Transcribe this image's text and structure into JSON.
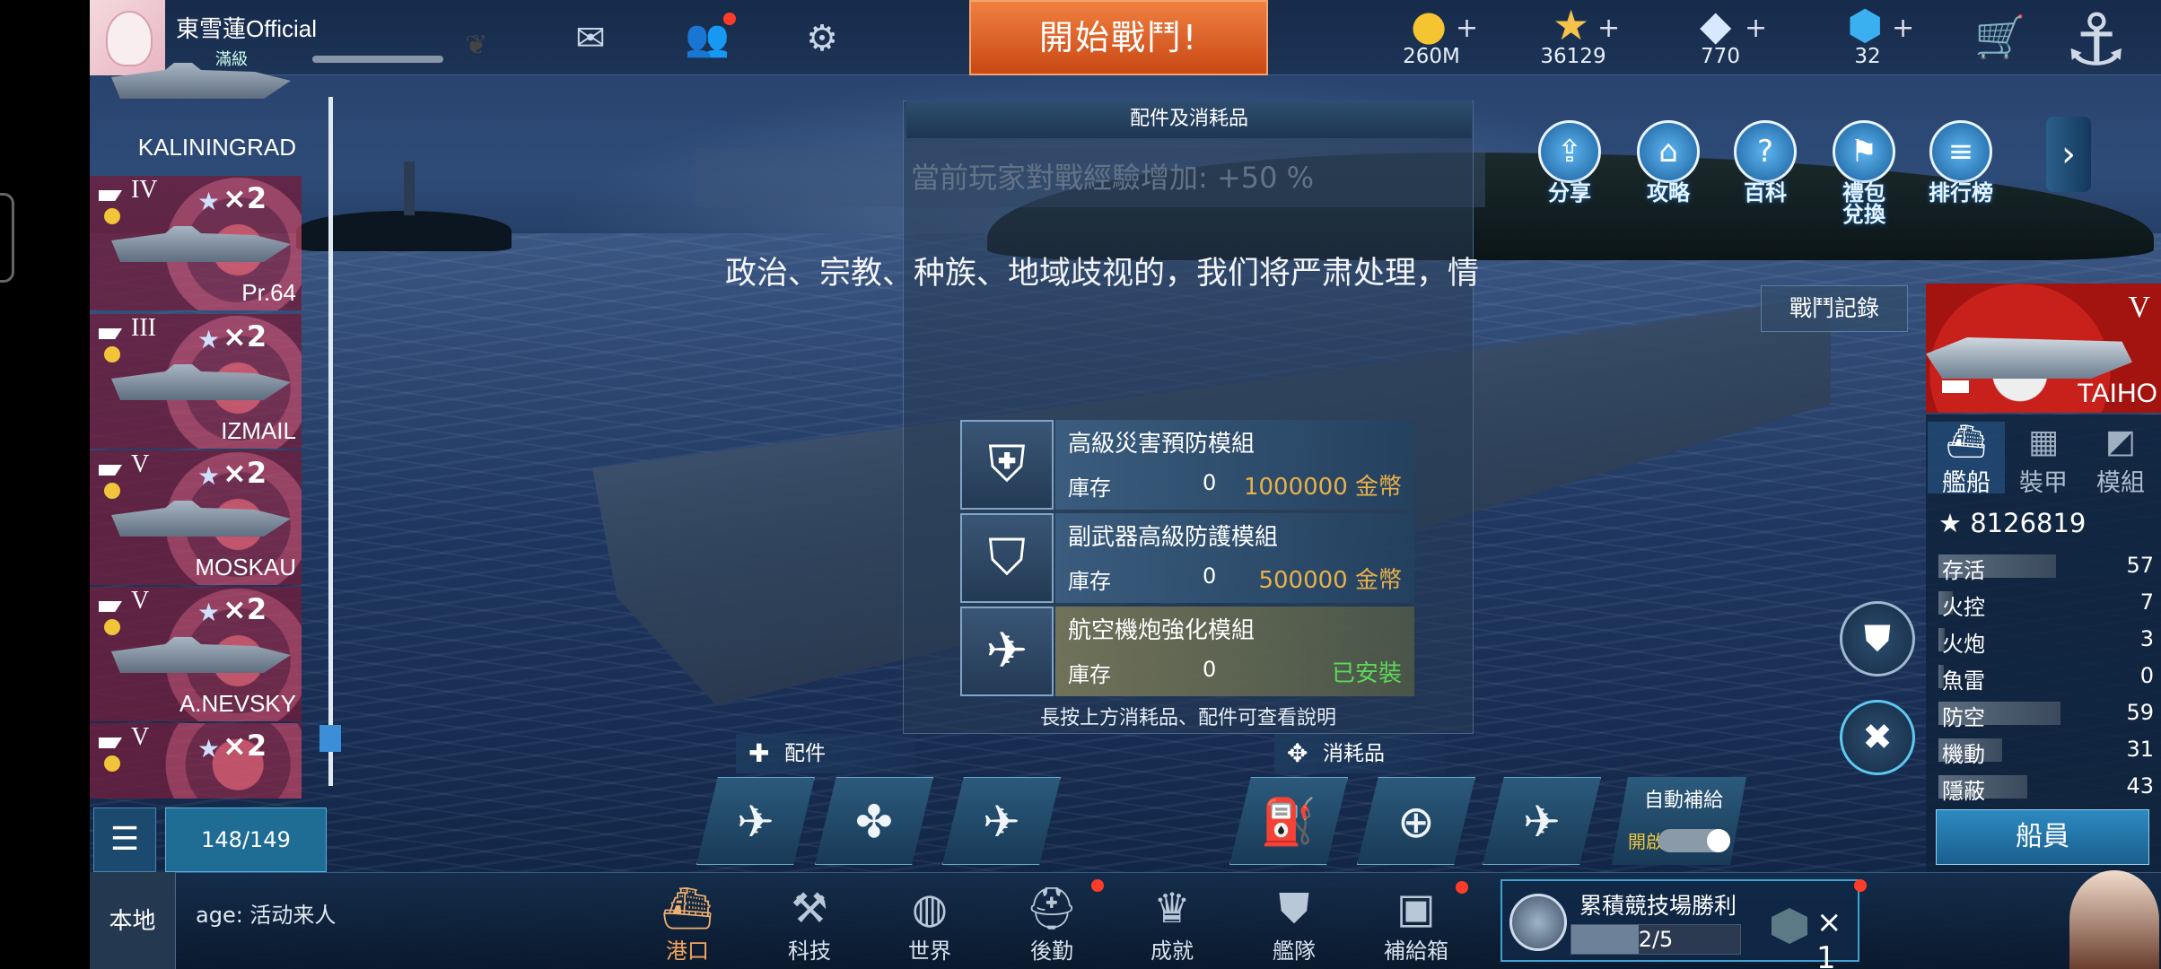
{
  "player": {
    "name": "東雪蓮Official",
    "level": "滿級"
  },
  "top": {
    "start_battle": "開始戰鬥!",
    "resources": [
      {
        "icon": "gold-coin-icon",
        "value": "260M"
      },
      {
        "icon": "star-icon",
        "value": "36129"
      },
      {
        "icon": "diamond-icon",
        "value": "770"
      },
      {
        "icon": "cube-icon",
        "value": "32"
      }
    ]
  },
  "ships": [
    {
      "tier": "",
      "multiplier": "",
      "name": "KALININGRAD"
    },
    {
      "tier": "IV",
      "multiplier": "×2",
      "name": "Pr.64"
    },
    {
      "tier": "III",
      "multiplier": "×2",
      "name": "IZMAIL"
    },
    {
      "tier": "V",
      "multiplier": "×2",
      "name": "MOSKAU"
    },
    {
      "tier": "V",
      "multiplier": "×2",
      "name": "A.NEVSKY"
    },
    {
      "tier": "V",
      "multiplier": "×2",
      "name": ""
    }
  ],
  "ship_count": "148/149",
  "features": {
    "share": "分享",
    "guide": "攻略",
    "wiki": "百科",
    "gift_line1": "禮包",
    "gift_line2": "兌換",
    "rank": "排行榜"
  },
  "battle_record": "戰鬥記錄",
  "modal": {
    "title": "配件及消耗品",
    "exp_bonus": "當前玩家對戰經驗增加: +50 %",
    "notice": "政治、宗教、种族、地域歧视的，我们将严肃处理，情",
    "items": [
      {
        "name": "高級災害預防模組",
        "stock_label": "庫存",
        "stock": "0",
        "price": "1000000 金幣"
      },
      {
        "name": "副武器高級防護模組",
        "stock_label": "庫存",
        "stock": "0",
        "price": "500000 金幣"
      },
      {
        "name": "航空機炮強化模組",
        "stock_label": "庫存",
        "stock": "0",
        "price": "已安裝"
      }
    ],
    "long_press_hint": "長按上方消耗品、配件可查看說明"
  },
  "sections": {
    "parts": "配件",
    "consumables": "消耗品"
  },
  "auto_supply": {
    "label": "自動補給",
    "state": "開啟"
  },
  "selected_ship": {
    "name": "TAIHO",
    "tier": "V",
    "tabs": [
      "艦船",
      "裝甲",
      "模組"
    ],
    "power": "8126819",
    "stats": [
      {
        "label": "存活",
        "value": "57",
        "fill": 0.57
      },
      {
        "label": "火控",
        "value": "7",
        "fill": 0.07
      },
      {
        "label": "火炮",
        "value": "3",
        "fill": 0.03
      },
      {
        "label": "魚雷",
        "value": "0",
        "fill": 0.0
      },
      {
        "label": "防空",
        "value": "59",
        "fill": 0.59
      },
      {
        "label": "機動",
        "value": "31",
        "fill": 0.31
      },
      {
        "label": "隱蔽",
        "value": "43",
        "fill": 0.43
      }
    ],
    "crew_button": "船員"
  },
  "bottom": {
    "local": "本地",
    "chat": "age: 活动来人",
    "nav": [
      "港口",
      "科技",
      "世界",
      "後勤",
      "成就",
      "艦隊",
      "補給箱"
    ]
  },
  "arena": {
    "title": "累積競技場勝利",
    "progress": "2/5",
    "progress_fraction": 0.4,
    "reward_multiplier": "× 1"
  },
  "colors": {
    "accent_orange": "#e06a2a",
    "active_nav": "#f7a55a",
    "price_gold": "#e8b14a",
    "installed_green": "#5cd85a"
  }
}
